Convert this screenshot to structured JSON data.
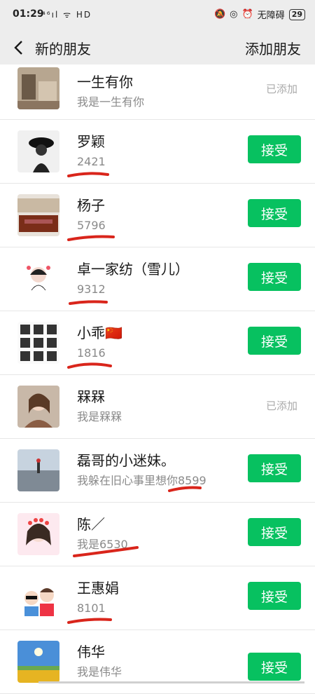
{
  "statusbar": {
    "time": "01:29",
    "left_icons": "⁴⁶ıl ᯤ HD",
    "no_disturb": "无障碍",
    "battery": "29"
  },
  "navbar": {
    "title": "新的朋友",
    "action": "添加朋友"
  },
  "requests": [
    {
      "name": "一生有你",
      "message": "我是一生有你",
      "status": "added",
      "status_label": "已添加"
    },
    {
      "name": "罗颖",
      "message": "2421",
      "status": "pending",
      "button_label": "接受",
      "redline": true
    },
    {
      "name": "杨子",
      "message": "5796",
      "status": "pending",
      "button_label": "接受",
      "redline": true
    },
    {
      "name": "卓一家纺（雪儿）",
      "message": "9312",
      "status": "pending",
      "button_label": "接受",
      "redline": true
    },
    {
      "name": "小乖🇨🇳",
      "message": "1816",
      "status": "pending",
      "button_label": "接受",
      "redline": true
    },
    {
      "name": "槑槑",
      "message": "我是槑槑",
      "status": "added",
      "status_label": "已添加"
    },
    {
      "name": "磊哥的小迷妹。",
      "message": "我躲在旧心事里想你8599",
      "status": "pending",
      "button_label": "接受",
      "redline": true
    },
    {
      "name": "陈／",
      "message": "我是6530",
      "status": "pending",
      "button_label": "接受",
      "redline": true
    },
    {
      "name": "王惠娟",
      "message": "8101",
      "status": "pending",
      "button_label": "接受",
      "redline": true
    },
    {
      "name": "伟华",
      "message": "我是伟华",
      "status": "pending",
      "button_label": "接受"
    }
  ],
  "colors": {
    "accent": "#07c160",
    "header_bg": "#ededed",
    "redline": "#d9251b"
  }
}
